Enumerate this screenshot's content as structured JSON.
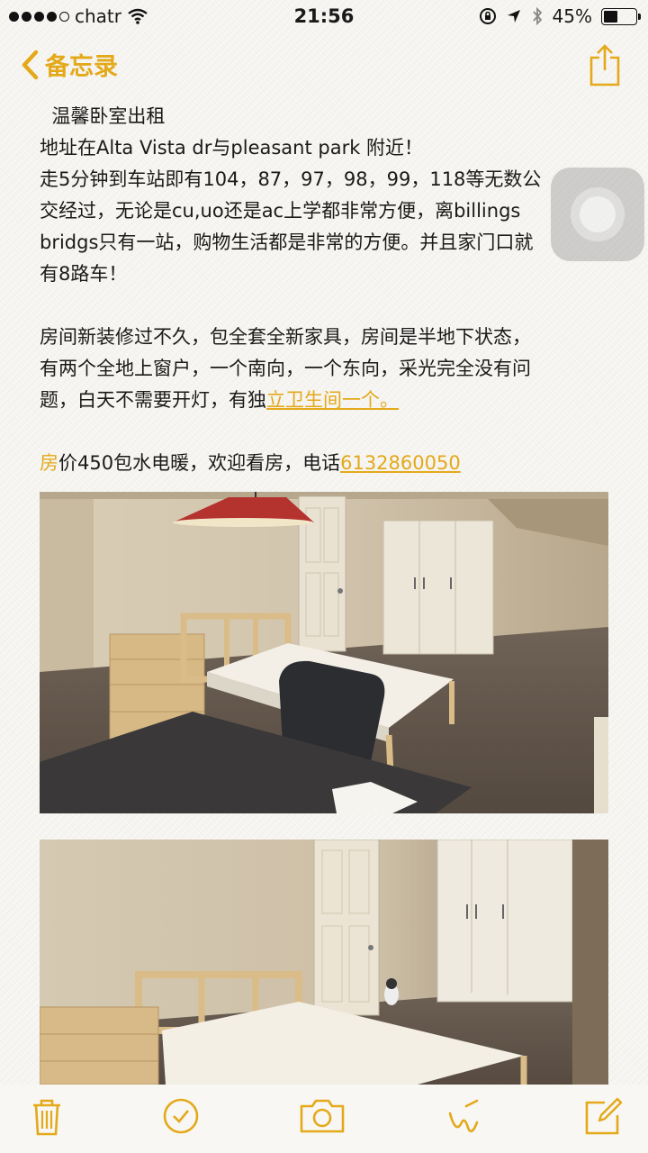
{
  "status_bar": {
    "carrier": "chatr",
    "time": "21:56",
    "battery_percent": "45%",
    "battery_level": 0.45,
    "signal_bars_filled": 4,
    "signal_bars_total": 5
  },
  "nav": {
    "back_label": "备忘录",
    "back_icon": "chevron-left-icon",
    "share_icon": "share-icon"
  },
  "note": {
    "title_line": "  温馨卧室出租",
    "address_line": "地址在Alta Vista dr与pleasant park 附近！",
    "transport_lines": [
      "走5分钟到车站即有104，87，97，98，99，118等无数公",
      "交经过，无论是cu,uo还是ac上学都非常方便，离billings",
      "bridgs只有一站，购物生活都是非常的方便。并且家门口就",
      "有8路车！"
    ],
    "room_lines": [
      "房间新装修过不久，包全套全新家具，房间是半地下状态，",
      "有两个全地上窗户，一个南向，一个东向，采光完全没有问"
    ],
    "room_last_plain": "题，白天不需要开灯，有独",
    "room_last_link": "立卫生间一个。",
    "price_first_char": "房",
    "price_text": "价450包水电暖，欢迎看房，电话",
    "phone_link": "6132860050"
  },
  "photos": [
    {
      "name": "bedroom-photo-1"
    },
    {
      "name": "bedroom-photo-2"
    }
  ],
  "toolbar": {
    "items": [
      "trash-icon",
      "checklist-icon",
      "camera-icon",
      "sketch-icon",
      "compose-icon"
    ]
  },
  "colors": {
    "accent": "#e4a91b",
    "background": "#f8f7f3",
    "text": "#1a1a1a"
  }
}
